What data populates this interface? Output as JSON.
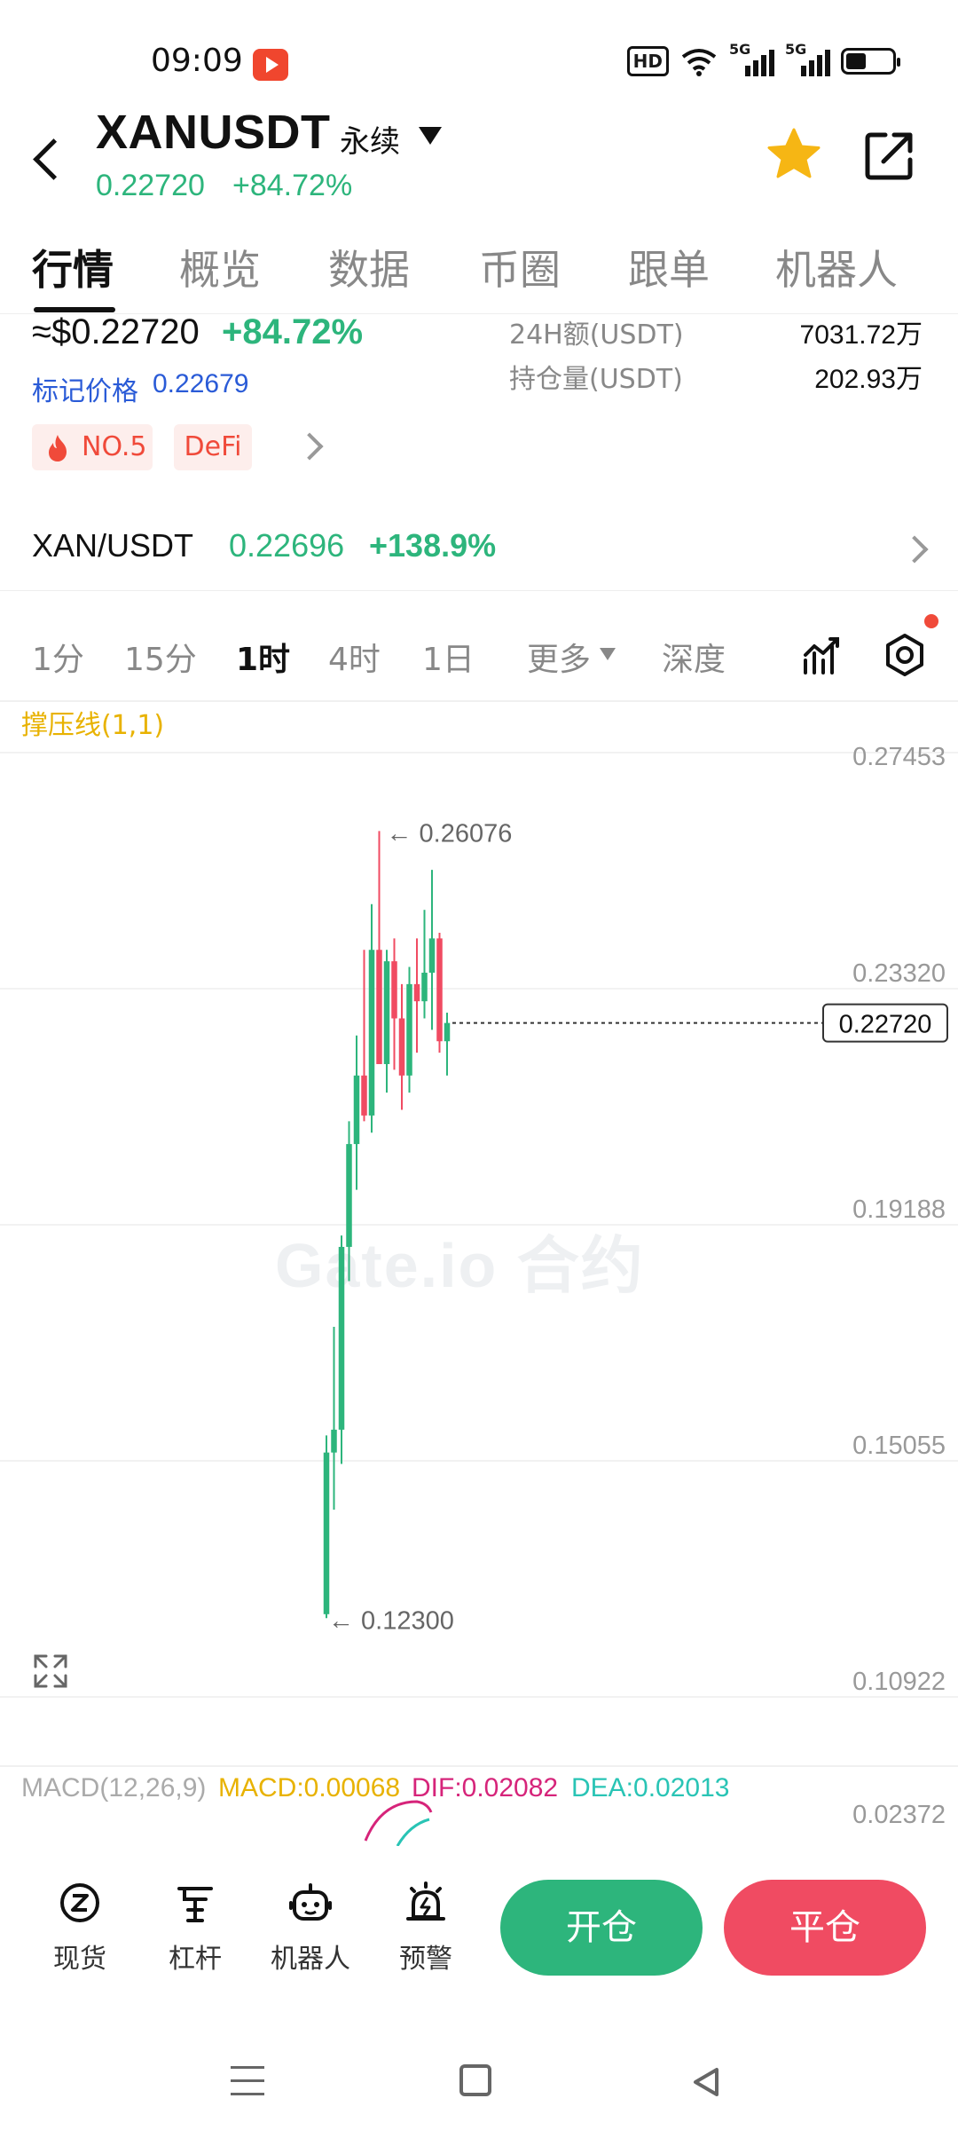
{
  "status_bar": {
    "time": "09:09",
    "network_labels": [
      "5G",
      "5G"
    ],
    "hd_label": "HD"
  },
  "header": {
    "pair": "XANUSDT",
    "contract_type": "永续",
    "price": "0.22720",
    "change": "+84.72%"
  },
  "tabs": [
    "行情",
    "概览",
    "数据",
    "币圈",
    "跟单",
    "机器人"
  ],
  "summary": {
    "approx_price": "≈$0.22720",
    "change": "+84.72%",
    "mark_label": "标记价格",
    "mark_value": "0.22679",
    "turnover_label": "24H额(USDT)",
    "turnover_value": "7031.72万",
    "oi_label": "持仓量(USDT)",
    "oi_value": "202.93万",
    "tags": [
      "NO.5",
      "DeFi"
    ]
  },
  "spot": {
    "name": "XAN/USDT",
    "price": "0.22696",
    "change": "+138.9%"
  },
  "intervals": [
    "1分",
    "15分",
    "1时",
    "4时",
    "1日",
    "更多",
    "深度"
  ],
  "indicator_label": "撑压线(1,1)",
  "watermark": "Gate.io 合约",
  "macd": {
    "params": "MACD(12,26,9)",
    "macd": "MACD:0.00068",
    "dif": "DIF:0.02082",
    "dea": "DEA:0.02013",
    "axis_label": "0.02372"
  },
  "chart_data": {
    "type": "candlestick",
    "y_ticks": [
      "0.27453",
      "0.23320",
      "0.19188",
      "0.15055",
      "0.10922"
    ],
    "y_tick_values": [
      0.27453,
      0.2332,
      0.19188,
      0.15055,
      0.10922
    ],
    "current_price": 0.2272,
    "current_price_label": "0.22720",
    "high_label": "← 0.26076",
    "high": 0.26076,
    "low_label": "← 0.12300",
    "low": 0.123,
    "up_color": "#2db57c",
    "down_color": "#f04b62",
    "candles": [
      {
        "o": 0.1237,
        "h": 0.155,
        "l": 0.123,
        "c": 0.152
      },
      {
        "o": 0.152,
        "h": 0.174,
        "l": 0.142,
        "c": 0.156
      },
      {
        "o": 0.156,
        "h": 0.19,
        "l": 0.15,
        "c": 0.188
      },
      {
        "o": 0.188,
        "h": 0.21,
        "l": 0.182,
        "c": 0.206
      },
      {
        "o": 0.206,
        "h": 0.225,
        "l": 0.198,
        "c": 0.218
      },
      {
        "o": 0.218,
        "h": 0.24,
        "l": 0.21,
        "c": 0.211
      },
      {
        "o": 0.211,
        "h": 0.248,
        "l": 0.208,
        "c": 0.24
      },
      {
        "o": 0.24,
        "h": 0.2608,
        "l": 0.222,
        "c": 0.22
      },
      {
        "o": 0.22,
        "h": 0.24,
        "l": 0.215,
        "c": 0.238
      },
      {
        "o": 0.238,
        "h": 0.242,
        "l": 0.219,
        "c": 0.228
      },
      {
        "o": 0.228,
        "h": 0.234,
        "l": 0.212,
        "c": 0.218
      },
      {
        "o": 0.218,
        "h": 0.237,
        "l": 0.215,
        "c": 0.234
      },
      {
        "o": 0.234,
        "h": 0.242,
        "l": 0.222,
        "c": 0.231
      },
      {
        "o": 0.231,
        "h": 0.247,
        "l": 0.228,
        "c": 0.236
      },
      {
        "o": 0.236,
        "h": 0.254,
        "l": 0.226,
        "c": 0.242
      },
      {
        "o": 0.242,
        "h": 0.243,
        "l": 0.222,
        "c": 0.224
      },
      {
        "o": 0.224,
        "h": 0.229,
        "l": 0.218,
        "c": 0.2272
      }
    ]
  },
  "bottom_nav": {
    "items": [
      "现货",
      "杠杆",
      "机器人",
      "预警"
    ],
    "open_label": "开仓",
    "close_label": "平仓"
  },
  "colors": {
    "green": "#2db57c",
    "red": "#f04b62",
    "accent_yellow": "#e8b200",
    "link_blue": "#2a5bd7",
    "macd_pink": "#d6247a",
    "macd_teal": "#29c4b5"
  }
}
